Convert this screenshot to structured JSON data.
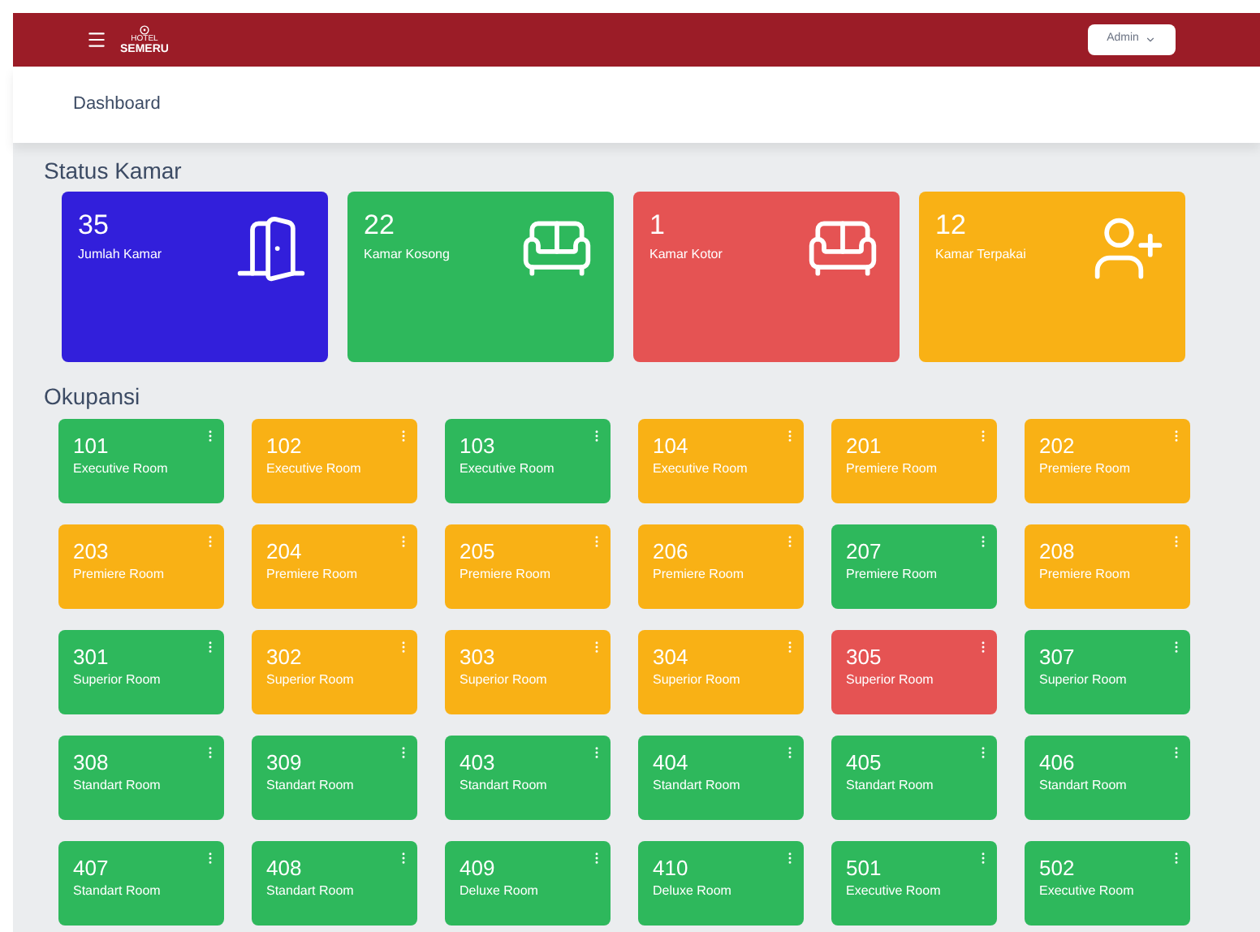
{
  "header": {
    "logo_small": "HOTEL",
    "logo": "SEMERU",
    "user_menu": "Admin"
  },
  "breadcrumb": "Dashboard",
  "status_title": "Status Kamar",
  "status_cards": [
    {
      "value": "35",
      "label": "Jumlah Kamar",
      "color": "#321fdb",
      "kind": "door"
    },
    {
      "value": "22",
      "label": "Kamar Kosong",
      "color": "#2eb85c",
      "kind": "sofa"
    },
    {
      "value": "1",
      "label": "Kamar Kotor",
      "color": "#e55353",
      "kind": "sofa"
    },
    {
      "value": "12",
      "label": "Kamar Terpakai",
      "color": "#f9b115",
      "kind": "user"
    }
  ],
  "occupancy_title": "Okupansi",
  "rooms": [
    {
      "number": "101",
      "type": "Executive Room",
      "color": "#2eb85c"
    },
    {
      "number": "102",
      "type": "Executive Room",
      "color": "#f9b115"
    },
    {
      "number": "103",
      "type": "Executive Room",
      "color": "#2eb85c"
    },
    {
      "number": "104",
      "type": "Executive Room",
      "color": "#f9b115"
    },
    {
      "number": "201",
      "type": "Premiere Room",
      "color": "#f9b115"
    },
    {
      "number": "202",
      "type": "Premiere Room",
      "color": "#f9b115"
    },
    {
      "number": "203",
      "type": "Premiere Room",
      "color": "#f9b115"
    },
    {
      "number": "204",
      "type": "Premiere Room",
      "color": "#f9b115"
    },
    {
      "number": "205",
      "type": "Premiere Room",
      "color": "#f9b115"
    },
    {
      "number": "206",
      "type": "Premiere Room",
      "color": "#f9b115"
    },
    {
      "number": "207",
      "type": "Premiere Room",
      "color": "#2eb85c"
    },
    {
      "number": "208",
      "type": "Premiere Room",
      "color": "#f9b115"
    },
    {
      "number": "301",
      "type": "Superior Room",
      "color": "#2eb85c"
    },
    {
      "number": "302",
      "type": "Superior Room",
      "color": "#f9b115"
    },
    {
      "number": "303",
      "type": "Superior Room",
      "color": "#f9b115"
    },
    {
      "number": "304",
      "type": "Superior Room",
      "color": "#f9b115"
    },
    {
      "number": "305",
      "type": "Superior Room",
      "color": "#e55353"
    },
    {
      "number": "307",
      "type": "Superior Room",
      "color": "#2eb85c"
    },
    {
      "number": "308",
      "type": "Standart Room",
      "color": "#2eb85c"
    },
    {
      "number": "309",
      "type": "Standart Room",
      "color": "#2eb85c"
    },
    {
      "number": "403",
      "type": "Standart Room",
      "color": "#2eb85c"
    },
    {
      "number": "404",
      "type": "Standart Room",
      "color": "#2eb85c"
    },
    {
      "number": "405",
      "type": "Standart Room",
      "color": "#2eb85c"
    },
    {
      "number": "406",
      "type": "Standart Room",
      "color": "#2eb85c"
    },
    {
      "number": "407",
      "type": "Standart Room",
      "color": "#2eb85c"
    },
    {
      "number": "408",
      "type": "Standart Room",
      "color": "#2eb85c"
    },
    {
      "number": "409",
      "type": "Deluxe Room",
      "color": "#2eb85c"
    },
    {
      "number": "410",
      "type": "Deluxe Room",
      "color": "#2eb85c"
    },
    {
      "number": "501",
      "type": "Executive Room",
      "color": "#2eb85c"
    },
    {
      "number": "502",
      "type": "Executive Room",
      "color": "#2eb85c"
    }
  ]
}
